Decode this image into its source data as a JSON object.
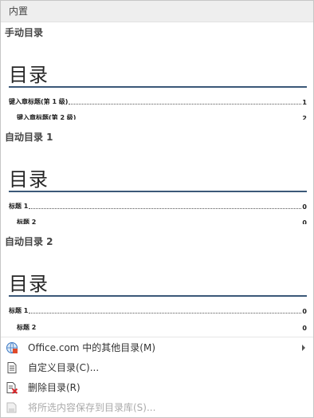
{
  "header": {
    "title": "内置"
  },
  "gallery": {
    "sections": [
      {
        "title": "手动目录",
        "heading": "目录",
        "lines": [
          {
            "text": "键入章标题(第 1 级)",
            "page": "1",
            "level": 1
          },
          {
            "text": "键入章标题(第 2 级)",
            "page": "2",
            "level": 2
          }
        ]
      },
      {
        "title": "自动目录 1",
        "heading": "目录",
        "lines": [
          {
            "text": "标题 1",
            "page": "0",
            "level": 1
          },
          {
            "text": "标题 2",
            "page": "0",
            "level": 2
          }
        ]
      },
      {
        "title": "自动目录 2",
        "heading": "目录",
        "lines": [
          {
            "text": "标题 1",
            "page": "0",
            "level": 1
          },
          {
            "text": "标题 2",
            "page": "0",
            "level": 2
          }
        ]
      }
    ]
  },
  "menu": {
    "items": [
      {
        "label": "Office.com 中的其他目录(M)",
        "icon": "office-globe-icon",
        "submenu": true,
        "enabled": true
      },
      {
        "label": "自定义目录(C)...",
        "icon": "document-icon",
        "submenu": false,
        "enabled": true
      },
      {
        "label": "删除目录(R)",
        "icon": "delete-document-icon",
        "submenu": false,
        "enabled": true
      },
      {
        "label": "将所选内容保存到目录库(S)...",
        "icon": "save-selection-icon",
        "submenu": false,
        "enabled": false
      }
    ]
  },
  "colors": {
    "rule": "#3b5878",
    "header_bg": "#eeeeee",
    "disabled": "#aaaaaa"
  }
}
